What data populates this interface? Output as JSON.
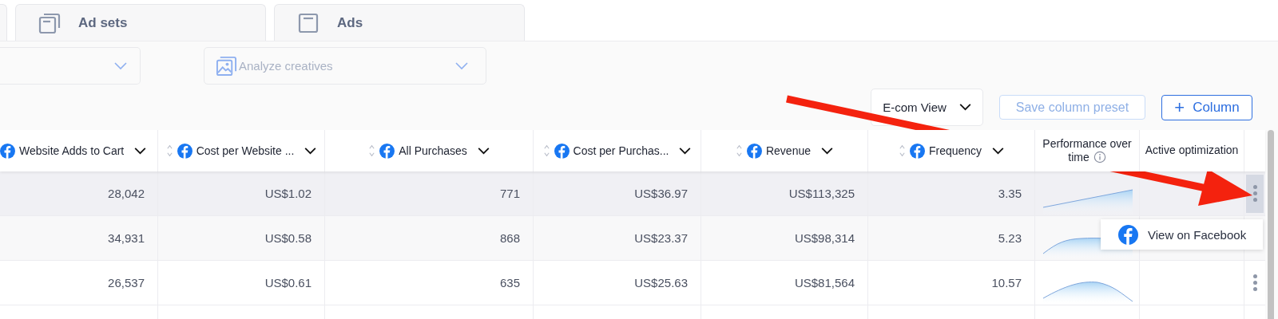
{
  "tabs": [
    {
      "label": "Ad sets"
    },
    {
      "label": "Ads"
    }
  ],
  "filters": {
    "analyze": {
      "placeholder": "Analyze creatives"
    }
  },
  "toolbar": {
    "view": "E-com View",
    "save": {
      "label": "Save column preset",
      "disabled": true
    },
    "add_column": {
      "symbol": "+",
      "label": "Column"
    }
  },
  "table": {
    "columns": [
      {
        "label": "Website Adds to Cart",
        "kind": "metric"
      },
      {
        "label": "Cost per Website ...",
        "kind": "metric"
      },
      {
        "label": "All Purchases",
        "kind": "metric"
      },
      {
        "label": "Cost per Purchas...",
        "kind": "metric"
      },
      {
        "label": "Revenue",
        "kind": "metric"
      },
      {
        "label": "Frequency",
        "kind": "metric"
      },
      {
        "label": "Performance over time",
        "kind": "chart"
      },
      {
        "label": "Active optimization",
        "kind": "plain"
      }
    ],
    "rows": [
      {
        "selected": true,
        "cells": [
          "28,042",
          "US$1.02",
          "771",
          "US$36.97",
          "US$113,325",
          "3.35"
        ]
      },
      {
        "selected": false,
        "cells": [
          "34,931",
          "US$0.58",
          "868",
          "US$23.37",
          "US$98,314",
          "5.23"
        ]
      },
      {
        "selected": false,
        "cells": [
          "26,537",
          "US$0.61",
          "635",
          "US$25.63",
          "US$81,564",
          "10.57"
        ]
      }
    ]
  },
  "row_menu": {
    "items": [
      {
        "label": "View on Facebook"
      }
    ]
  }
}
